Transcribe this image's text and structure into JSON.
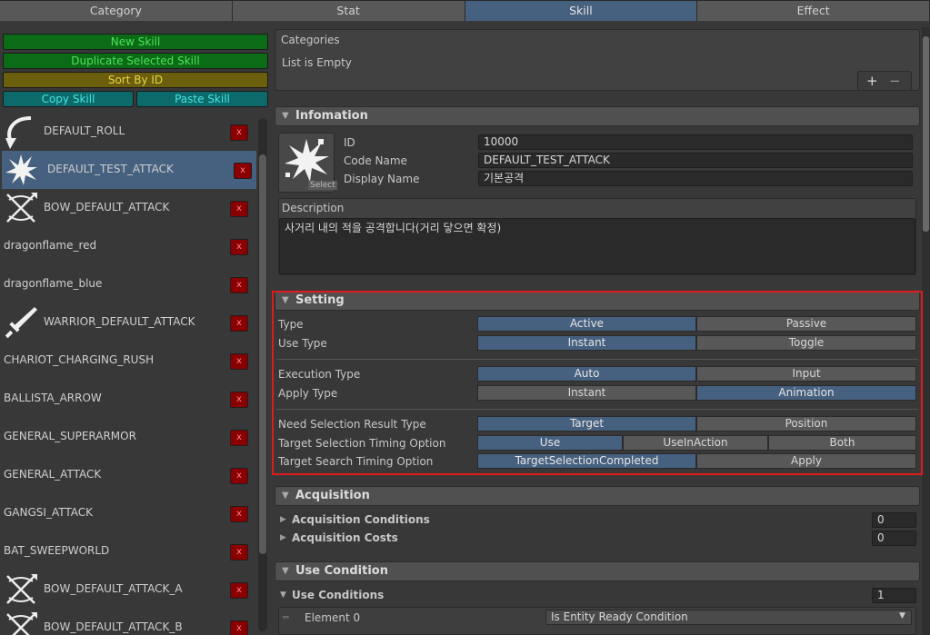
{
  "tabs": [
    {
      "label": "Category",
      "active": false
    },
    {
      "label": "Stat",
      "active": false
    },
    {
      "label": "Skill",
      "active": true
    },
    {
      "label": "Effect",
      "active": false
    }
  ],
  "toolbar": {
    "new_skill": "New Skill",
    "duplicate": "Duplicate Selected Skill",
    "sort": "Sort By ID",
    "copy": "Copy Skill",
    "paste": "Paste Skill"
  },
  "skill_list": [
    {
      "label": "DEFAULT_ROLL",
      "icon": "roll-arrow-icon"
    },
    {
      "label": "DEFAULT_TEST_ATTACK",
      "icon": "impact-burst-icon",
      "selected": true
    },
    {
      "label": "BOW_DEFAULT_ATTACK",
      "icon": "crossed-bow-icon"
    },
    {
      "label": "dragonflame_red",
      "icon": ""
    },
    {
      "label": "dragonflame_blue",
      "icon": ""
    },
    {
      "label": "WARRIOR_DEFAULT_ATTACK",
      "icon": "sword-icon"
    },
    {
      "label": "CHARIOT_CHARGING_RUSH",
      "icon": ""
    },
    {
      "label": "BALLISTA_ARROW",
      "icon": ""
    },
    {
      "label": "GENERAL_SUPERARMOR",
      "icon": ""
    },
    {
      "label": "GENERAL_ATTACK",
      "icon": ""
    },
    {
      "label": "GANGSI_ATTACK",
      "icon": ""
    },
    {
      "label": "BAT_SWEEPWORLD",
      "icon": ""
    },
    {
      "label": "BOW_DEFAULT_ATTACK_A",
      "icon": "crossed-bow-icon"
    },
    {
      "label": "BOW_DEFAULT_ATTACK_B",
      "icon": "crossed-bow-icon"
    }
  ],
  "delete_glyph": "x",
  "categories": {
    "title": "Categories",
    "empty": "List is Empty",
    "add": "+",
    "remove": "−"
  },
  "information": {
    "title": "Infomation",
    "select_label": "Select",
    "id_label": "ID",
    "id_value": "10000",
    "code_label": "Code Name",
    "code_value": "DEFAULT_TEST_ATTACK",
    "display_label": "Display Name",
    "display_value": "기본공격",
    "desc_label": "Description",
    "desc_value": "사거리 내의 적을 공격합니다(거리 닿으면 확정)"
  },
  "setting": {
    "title": "Setting",
    "type_label": "Type",
    "type_options": [
      "Active",
      "Passive"
    ],
    "use_type_label": "Use Type",
    "use_type_options": [
      "Instant",
      "Toggle"
    ],
    "exec_label": "Execution Type",
    "exec_options": [
      "Auto",
      "Input"
    ],
    "apply_label": "Apply Type",
    "apply_options": [
      "Instant",
      "Animation"
    ],
    "need_label": "Need Selection Result Type",
    "need_options": [
      "Target",
      "Position"
    ],
    "timing_label": "Target Selection Timing Option",
    "timing_options": [
      "Use",
      "UseInAction",
      "Both"
    ],
    "search_label": "Target Search Timing Option",
    "search_options": [
      "TargetSelectionCompleted",
      "Apply"
    ]
  },
  "acquisition": {
    "title": "Acquisition",
    "conditions_label": "Acquisition Conditions",
    "conditions_value": "0",
    "costs_label": "Acquisition Costs",
    "costs_value": "0"
  },
  "use_condition": {
    "title": "Use Condition",
    "conditions_label": "Use Conditions",
    "conditions_value": "1",
    "element_label": "Element 0",
    "element_value": "Is Entity Ready Condition"
  },
  "colors": {
    "highlight": "#e01b1b",
    "selected": "#46607f",
    "delete": "#8a0000"
  }
}
